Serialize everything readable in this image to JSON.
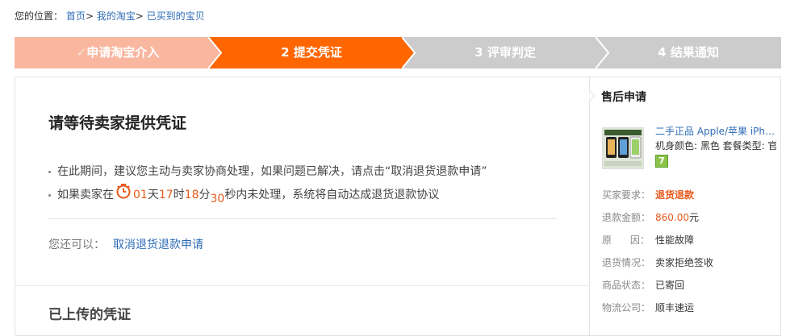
{
  "breadcrumb": {
    "prefix": "您的位置：",
    "items": [
      "首页",
      "我的淘宝",
      "已买到的宝贝"
    ],
    "sep": ">"
  },
  "steps": [
    {
      "label": "申请淘宝介入",
      "state": "done",
      "check": "✓"
    },
    {
      "label": "2  提交凭证",
      "state": "active"
    },
    {
      "label": "3  评审判定",
      "state": "todo"
    },
    {
      "label": "4  结果通知",
      "state": "todo"
    }
  ],
  "colors": {
    "done": "#f9b7a0",
    "active": "#ff6600",
    "todo": "#cccccc",
    "accent": "#e85a1d",
    "link": "#2d6bb7"
  },
  "main": {
    "title": "请等待卖家提供凭证",
    "tip1": "在此期间，建议您主动与卖家协商处理，如果问题已解决，请点击“取消退货退款申请”",
    "tip2_prefix": "如果卖家在",
    "countdown": {
      "days": "01",
      "days_unit": "天",
      "hours": "17",
      "hours_unit": "时",
      "minutes": "18",
      "minutes_unit": "分",
      "seconds": "30",
      "seconds_unit": "秒"
    },
    "tip2_suffix": "内未处理，系统将自动达成退货退款协议",
    "also_label": "您还可以：",
    "cancel_link": "取消退货退款申请",
    "uploaded_title": "已上传的凭证"
  },
  "side": {
    "title": "售后申请",
    "product_title": "二手正品 Apple/苹果 iPhone",
    "product_attr": "机身颜色: 黑色  套餐类型: 官方标配",
    "badge": "7",
    "fields": [
      {
        "k": "买家要求：",
        "v": "退货退款",
        "style": "strong"
      },
      {
        "k": "退款金额：",
        "v": "860.00",
        "unit": "元",
        "style": "amount"
      },
      {
        "k": "原      因：",
        "v": "性能故障"
      },
      {
        "k": "退货情况：",
        "v": "卖家拒绝签收"
      },
      {
        "k": "商品状态：",
        "v": "已寄回"
      },
      {
        "k": "物流公司：",
        "v": "顺丰速运"
      }
    ]
  }
}
